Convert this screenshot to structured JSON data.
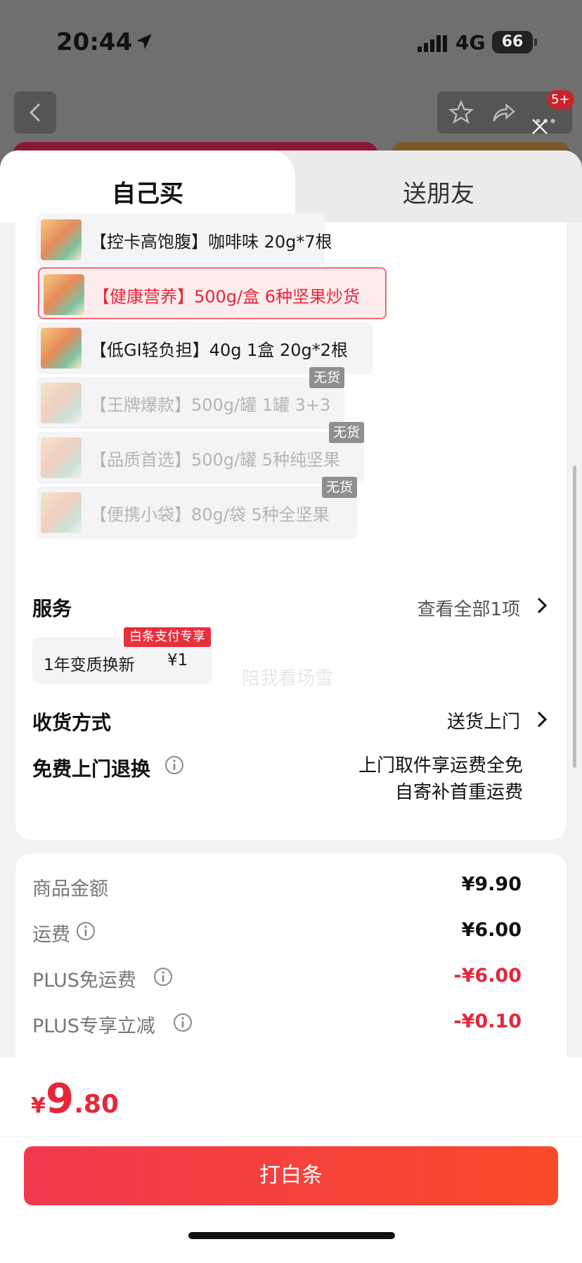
{
  "status_bar": {
    "time": "20:44",
    "network": "4G",
    "battery": "66"
  },
  "header": {
    "notification_badge": "5+"
  },
  "tabs": [
    {
      "label": "自己买",
      "active": true
    },
    {
      "label": "送朋友",
      "active": false
    }
  ],
  "variants": [
    {
      "label": "【控卡高饱腹】咖啡味 20g*7根",
      "state": "available"
    },
    {
      "label": "【健康营养】500g/盒 6种坚果炒货",
      "state": "selected"
    },
    {
      "label": "【低GI轻负担】40g 1盒 20g*2根",
      "state": "available"
    },
    {
      "label": "【王牌爆款】500g/罐 1罐 3+3",
      "state": "out_of_stock"
    },
    {
      "label": "【品质首选】500g/罐 5种纯坚果",
      "state": "out_of_stock"
    },
    {
      "label": "【便携小袋】80g/袋 5种全坚果",
      "state": "out_of_stock"
    }
  ],
  "out_of_stock_label": "无货",
  "watermark": "陪我看场雪",
  "service": {
    "title": "服务",
    "view_all": "查看全部1项",
    "item_name": "1年变质换新",
    "item_price": "¥1",
    "item_tag": "白条支付专享"
  },
  "delivery": {
    "title": "收货方式",
    "value": "送货上门"
  },
  "returns": {
    "title": "免费上门退换",
    "line1": "上门取件享运费全免",
    "line2": "自寄补首重运费"
  },
  "price_rows": [
    {
      "label": "商品金额",
      "value": "¥9.90",
      "negative": false,
      "info": false
    },
    {
      "label": "运费",
      "value": "¥6.00",
      "negative": false,
      "info": true
    },
    {
      "label": "PLUS免运费",
      "value": "-¥6.00",
      "negative": true,
      "info": true
    },
    {
      "label": "PLUS专享立减",
      "value": "-¥0.10",
      "negative": true,
      "info": true
    }
  ],
  "total": {
    "currency": "¥",
    "integer": "9",
    "decimal": ".80"
  },
  "pay_button": "打白条",
  "colors": {
    "accent_red": "#e6273b",
    "selected_bg": "#fdecee",
    "oos_badge": "#8f8f8f"
  }
}
